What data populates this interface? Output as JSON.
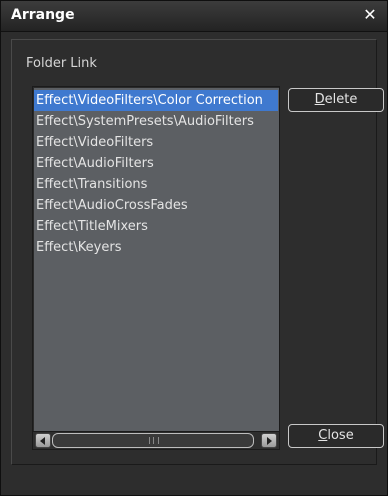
{
  "window": {
    "title": "Arrange",
    "close_glyph": "✕"
  },
  "group": {
    "label": "Folder Link"
  },
  "list": {
    "items": [
      "Effect\\VideoFilters\\Color Correction",
      "Effect\\SystemPresets\\AudioFilters",
      "Effect\\VideoFilters",
      "Effect\\AudioFilters",
      "Effect\\Transitions",
      "Effect\\AudioCrossFades",
      "Effect\\TitleMixers",
      "Effect\\Keyers"
    ],
    "selected_index": 0
  },
  "buttons": {
    "delete": {
      "mnemonic": "D",
      "rest": "elete"
    },
    "close": {
      "mnemonic": "C",
      "rest": "lose"
    }
  },
  "colors": {
    "selection": "#3f79cf",
    "list_background": "#5c5f63",
    "window_background": "#2d2d2d"
  }
}
